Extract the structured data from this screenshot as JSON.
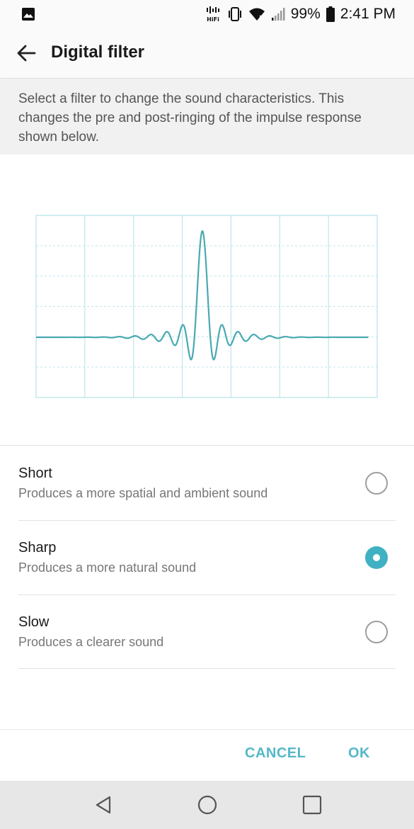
{
  "status_bar": {
    "battery": "99%",
    "time": "2:41 PM",
    "icons": [
      "gallery-icon",
      "hifi-icon",
      "vibrate-icon",
      "wifi-icon",
      "signal-icon",
      "battery-icon"
    ]
  },
  "app_bar": {
    "title": "Digital filter",
    "back_icon": "arrow-back-icon"
  },
  "description": "Select a filter to change the sound characteristics. This changes the pre and post-ringing of the impulse response shown below.",
  "options": [
    {
      "title": "Short",
      "description": "Produces a more spatial and ambient sound",
      "selected": false
    },
    {
      "title": "Sharp",
      "description": "Produces a more natural sound",
      "selected": true
    },
    {
      "title": "Slow",
      "description": "Produces a clearer sound",
      "selected": false
    }
  ],
  "buttons": {
    "cancel": "CANCEL",
    "ok": "OK"
  },
  "nav_bar": {
    "icons": [
      "back-triangle-icon",
      "home-circle-icon",
      "recents-square-icon"
    ]
  },
  "colors": {
    "accent": "#3fb1c2",
    "waveform": "#4aa9b1",
    "grid": "#bfe6ec"
  }
}
